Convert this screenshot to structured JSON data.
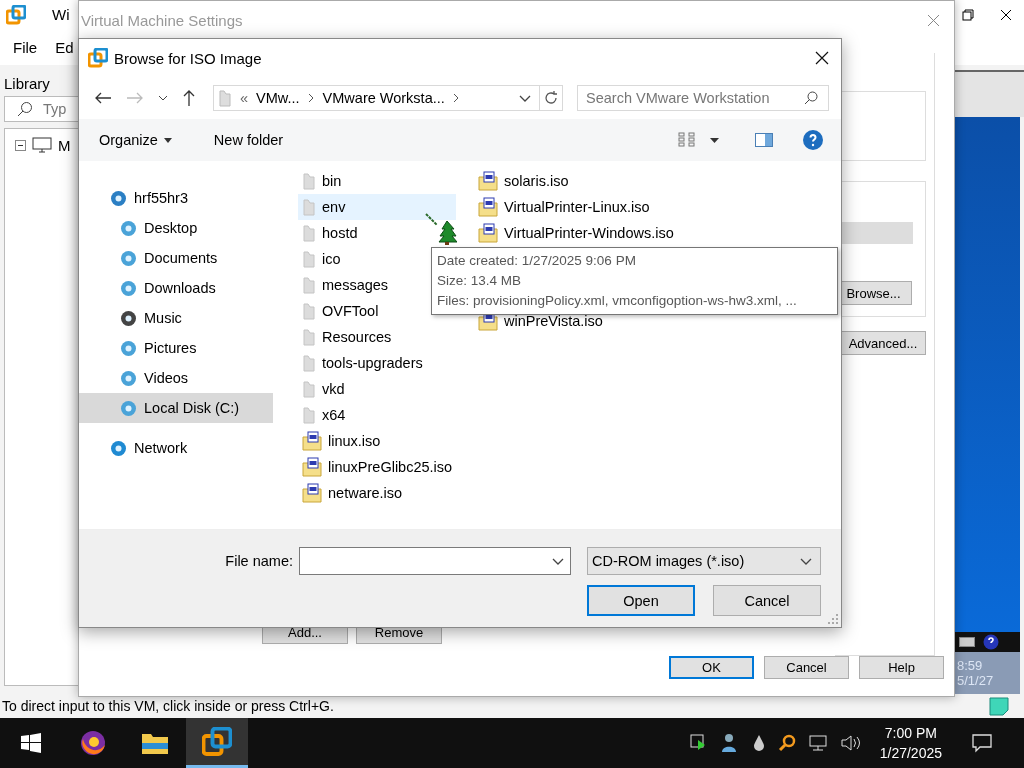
{
  "host_window": {
    "title": "Wi",
    "menu": [
      "File",
      "Ed"
    ],
    "library_title": "Library",
    "search_placeholder": "Typ",
    "tree": [
      {
        "label": "M",
        "expanded": true
      }
    ],
    "status_text": "To direct input to this VM, click inside or press Ctrl+G.",
    "vm_clock": {
      "time": "8:59",
      "date": "5/1/27"
    }
  },
  "settings_window": {
    "title": "Virtual Machine Settings",
    "list_buttons": [
      "Add...",
      "Remove"
    ],
    "side_buttons": [
      "Browse...",
      "Advanced..."
    ],
    "dialog_buttons": [
      {
        "label": "OK",
        "default": true
      },
      {
        "label": "Cancel",
        "default": false
      },
      {
        "label": "Help",
        "default": false
      }
    ]
  },
  "browse_dialog": {
    "title": "Browse for ISO Image",
    "overflow": "«",
    "breadcrumb": [
      "VMw...",
      "VMware Worksta..."
    ],
    "search_placeholder": "Search VMware Workstation",
    "commands": [
      {
        "label": "Organize",
        "menu": true
      },
      {
        "label": "New folder",
        "menu": false
      }
    ],
    "nav": [
      {
        "label": "hrf55hr3",
        "kind": "computer",
        "selected": false,
        "children": [
          {
            "label": "Desktop",
            "kind": "library",
            "selected": false
          },
          {
            "label": "Documents",
            "kind": "library",
            "selected": false
          },
          {
            "label": "Downloads",
            "kind": "library",
            "selected": false
          },
          {
            "label": "Music",
            "kind": "music",
            "selected": false
          },
          {
            "label": "Pictures",
            "kind": "library",
            "selected": false
          },
          {
            "label": "Videos",
            "kind": "library",
            "selected": false
          },
          {
            "label": "Local Disk (C:)",
            "kind": "drive",
            "selected": true
          }
        ]
      },
      {
        "label": "Network",
        "kind": "network",
        "selected": false
      }
    ],
    "file_columns": [
      [
        {
          "name": "bin",
          "kind": "folder",
          "selected": false
        },
        {
          "name": "env",
          "kind": "folder",
          "selected": true
        },
        {
          "name": "hostd",
          "kind": "folder",
          "selected": false
        },
        {
          "name": "ico",
          "kind": "folder",
          "selected": false
        },
        {
          "name": "messages",
          "kind": "folder",
          "selected": false
        },
        {
          "name": "OVFTool",
          "kind": "folder",
          "selected": false
        },
        {
          "name": "Resources",
          "kind": "folder",
          "selected": false
        },
        {
          "name": "tools-upgraders",
          "kind": "folder",
          "selected": false
        },
        {
          "name": "vkd",
          "kind": "folder",
          "selected": false
        },
        {
          "name": "x64",
          "kind": "folder",
          "selected": false
        },
        {
          "name": "linux.iso",
          "kind": "iso",
          "selected": false
        },
        {
          "name": "linuxPreGlibc25.iso",
          "kind": "iso",
          "selected": false
        },
        {
          "name": "netware.iso",
          "kind": "iso",
          "selected": false
        }
      ],
      [
        {
          "name": "solaris.iso",
          "kind": "iso",
          "selected": false
        },
        {
          "name": "VirtualPrinter-Linux.iso",
          "kind": "iso",
          "selected": false
        },
        {
          "name": "VirtualPrinter-Windows.iso",
          "kind": "iso",
          "selected": false
        },
        {
          "name": "winPreVista.iso",
          "kind": "iso",
          "selected": false
        }
      ]
    ],
    "tooltip": [
      "Date created: 1/27/2025 9:06 PM",
      "Size: 13.4 MB",
      "Files: provisioningPolicy.xml, vmconfigoption-ws-hw3.xml, ..."
    ],
    "file_name_label": "File name:",
    "file_type": "CD-ROM images (*.iso)",
    "buttons": [
      {
        "label": "Open",
        "default": true
      },
      {
        "label": "Cancel",
        "default": false
      }
    ]
  },
  "taskbar": {
    "apps": [
      {
        "kind": "start",
        "active": false
      },
      {
        "kind": "firefox",
        "active": false
      },
      {
        "kind": "explorer",
        "active": false
      },
      {
        "kind": "vmware",
        "active": true
      }
    ],
    "time": "7:00 PM",
    "date": "1/27/2025"
  }
}
